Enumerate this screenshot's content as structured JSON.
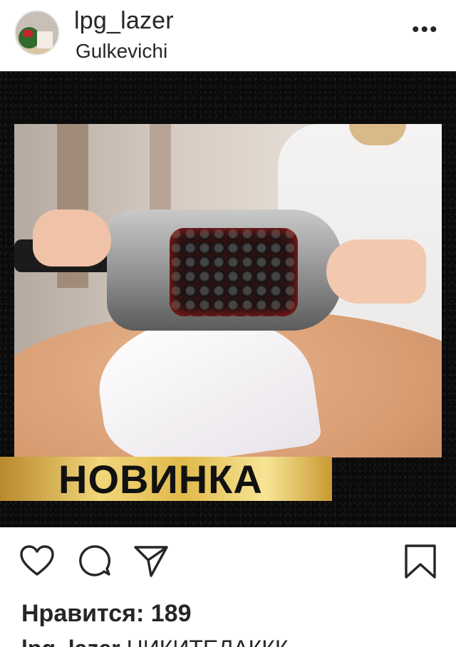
{
  "header": {
    "username": "lpg_lazer",
    "location": "Gulkevichi",
    "more_icon": "ellipsis-icon",
    "more_label": "•••"
  },
  "post": {
    "banner_text": "НОВИНКА",
    "colors": {
      "background": "#0b0b0b",
      "banner_gold": "#e0b94a"
    }
  },
  "actions": {
    "like_icon": "heart-icon",
    "comment_icon": "comment-icon",
    "share_icon": "paper-plane-icon",
    "save_icon": "bookmark-icon"
  },
  "likes": {
    "text": "Нравится: 189"
  },
  "caption": {
    "username": "lpg_lazer",
    "text": "НИКИТЕЛАККК"
  }
}
